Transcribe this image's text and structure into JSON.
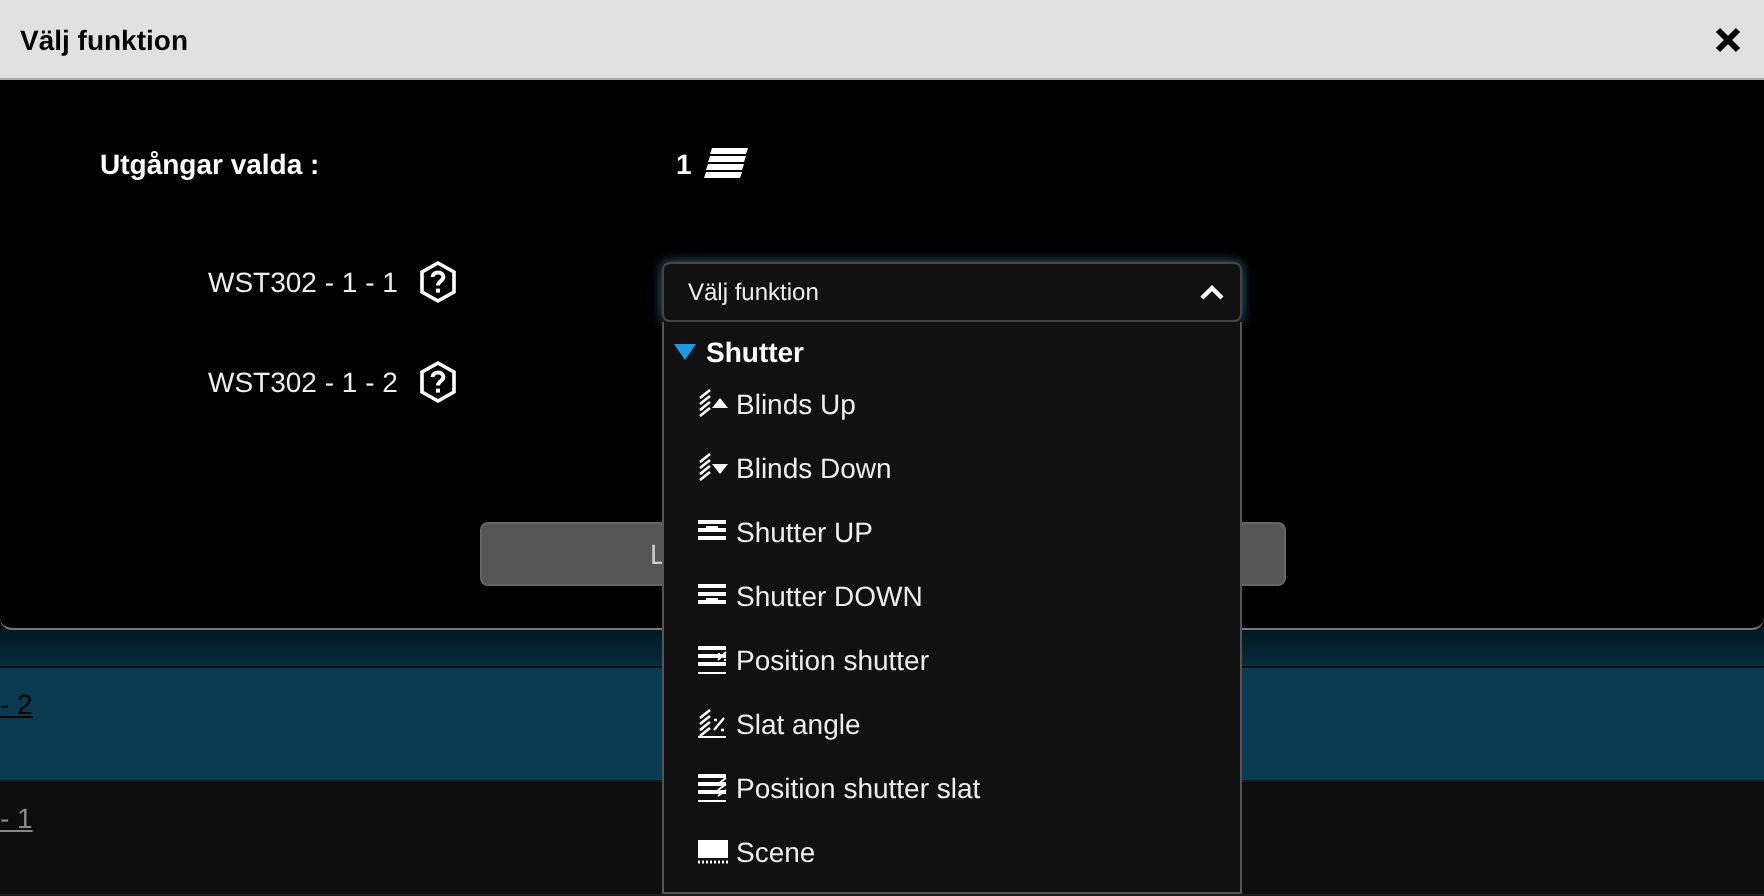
{
  "background_rows": [
    {
      "label": "- 2",
      "selected": true
    },
    {
      "label": "- 1",
      "selected": false
    }
  ],
  "dialog": {
    "title": "Välj funktion",
    "outputs_label": "Utgångar valda :",
    "outputs_count": "1",
    "outputs": [
      {
        "name": "WST302 - 1 - 1"
      },
      {
        "name": "WST302 - 1 - 2"
      }
    ],
    "button": "L",
    "dropdown": {
      "value": "Välj funktion",
      "expanded": true,
      "groups": [
        {
          "name": "Shutter",
          "expanded": true,
          "items": [
            {
              "label": "Blinds Up",
              "kind": "blinds-up"
            },
            {
              "label": "Blinds Down",
              "kind": "blinds-down"
            },
            {
              "label": "Shutter UP",
              "kind": "shutter-up"
            },
            {
              "label": "Shutter DOWN",
              "kind": "shutter-down"
            },
            {
              "label": "Position shutter",
              "kind": "position-shutter"
            },
            {
              "label": "Slat angle",
              "kind": "slat-angle"
            },
            {
              "label": "Position shutter slat",
              "kind": "position-slat"
            },
            {
              "label": "Scene",
              "kind": "scene"
            }
          ]
        }
      ]
    }
  }
}
